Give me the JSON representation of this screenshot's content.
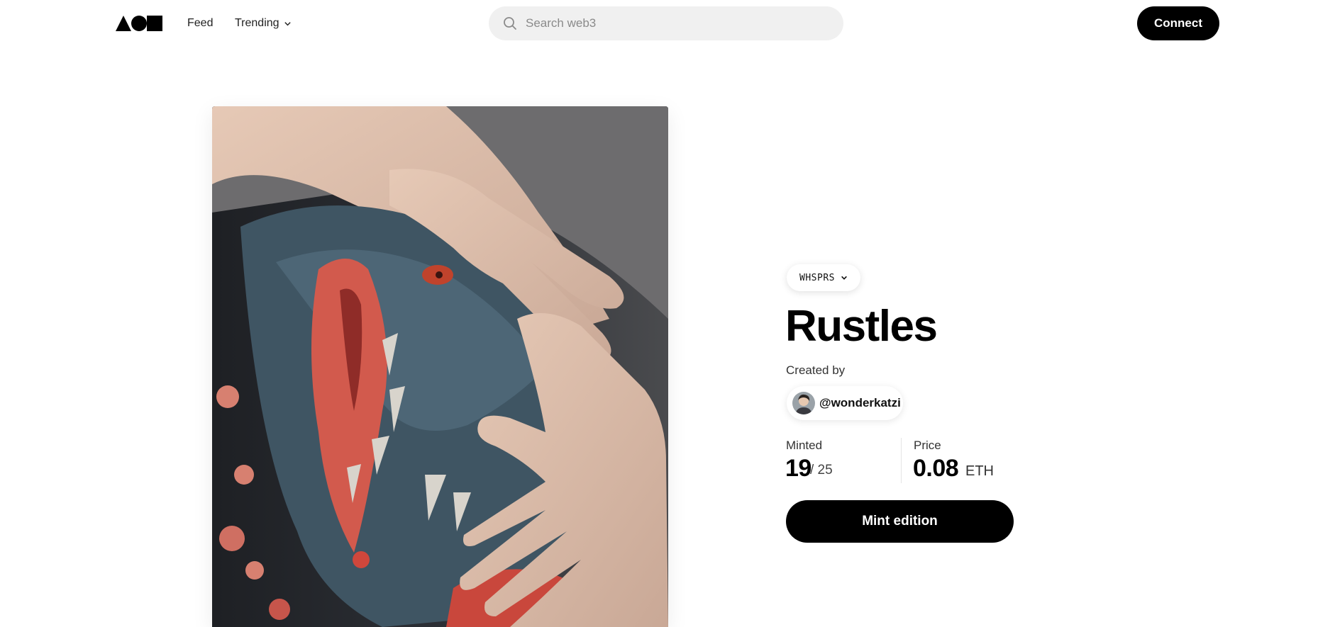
{
  "header": {
    "logo_icon": "shapes-logo-icon",
    "nav": {
      "feed_label": "Feed",
      "trending_label": "Trending",
      "trending_icon": "chevron-down-icon"
    },
    "search": {
      "icon": "search-icon",
      "placeholder": "Search web3",
      "value": ""
    },
    "connect_label": "Connect"
  },
  "artwork": {
    "description_icon": "artwork-image"
  },
  "details": {
    "collection_label": "WHSPRS",
    "collection_icon": "chevron-down-icon",
    "title": "Rustles",
    "created_by_label": "Created by",
    "creator_handle": "@wonderkatzi",
    "minted_label": "Minted",
    "minted_count": "19",
    "minted_total": "/ 25",
    "price_label": "Price",
    "price_value": "0.08",
    "price_currency": "ETH",
    "mint_button_label": "Mint edition"
  },
  "colors": {
    "primary": "#000000",
    "background": "#ffffff",
    "search_bg": "#f0f0f0"
  }
}
